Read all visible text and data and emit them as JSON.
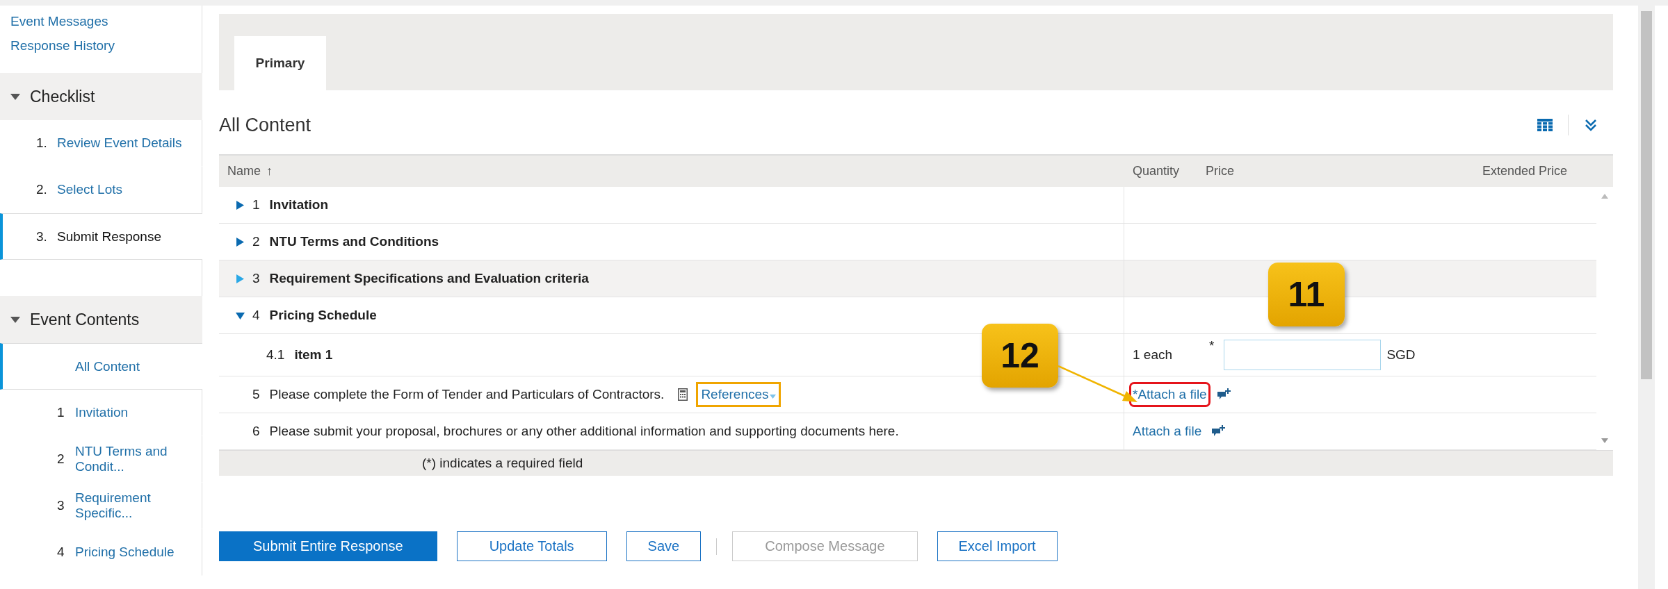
{
  "sidebar": {
    "links": [
      "Event Messages",
      "Response History"
    ],
    "sections": [
      {
        "title": "Checklist",
        "expanded": true,
        "items": [
          {
            "number": "1.",
            "label": "Review Event Details",
            "selected": false
          },
          {
            "number": "2.",
            "label": "Select Lots",
            "selected": false
          },
          {
            "number": "3.",
            "label": "Submit Response",
            "selected": true
          }
        ]
      },
      {
        "title": "Event Contents",
        "expanded": true,
        "items": [
          {
            "label": "All Content",
            "selected": true
          },
          {
            "number": "1",
            "label": "Invitation",
            "selected": false
          },
          {
            "number": "2",
            "label": "NTU Terms and Condit...",
            "selected": false
          },
          {
            "number": "3",
            "label": "Requirement Specific...",
            "selected": false
          },
          {
            "number": "4",
            "label": "Pricing Schedule",
            "selected": false
          }
        ]
      }
    ]
  },
  "tabs": [
    {
      "label": "Primary",
      "selected": true
    }
  ],
  "content": {
    "title": "All Content",
    "columns": {
      "name": "Name",
      "sort_icon": "↑",
      "quantity": "Quantity",
      "price": "Price",
      "extended_price": "Extended Price"
    },
    "rows": [
      {
        "kind": "group",
        "number": "1",
        "label": "Invitation",
        "expanded": false,
        "highlighted": false
      },
      {
        "kind": "group",
        "number": "2",
        "label": "NTU Terms and Conditions",
        "expanded": false,
        "highlighted": false
      },
      {
        "kind": "group",
        "number": "3",
        "label": "Requirement Specifications and Evaluation criteria",
        "expanded": false,
        "highlighted": true
      },
      {
        "kind": "group",
        "number": "4",
        "label": "Pricing Schedule",
        "expanded": true,
        "highlighted": false
      },
      {
        "kind": "item",
        "number": "4.1",
        "label": "item 1",
        "quantity": "1 each",
        "required": true,
        "required_mark": "*",
        "currency": "SGD",
        "highlighted": false
      },
      {
        "kind": "question",
        "number": "5",
        "label": "Please complete the Form of Tender and Particulars of Contractors.",
        "references": "References",
        "references_outlined": true,
        "attach": "*Attach a file",
        "attach_outlined": true,
        "highlighted": false
      },
      {
        "kind": "question",
        "number": "6",
        "label": "Please submit your proposal, brochures or any other additional information and supporting documents here.",
        "attach": "Attach a file",
        "attach_outlined": false,
        "highlighted": false
      }
    ],
    "footnote": "(*) indicates a required field"
  },
  "buttons": [
    {
      "label": "Submit Entire Response",
      "kind": "primary"
    },
    {
      "label": "Update Totals",
      "kind": "secondary"
    },
    {
      "label": "Save",
      "kind": "secondary"
    },
    {
      "label": "Compose Message",
      "kind": "disabled"
    },
    {
      "label": "Excel Import",
      "kind": "secondary"
    }
  ],
  "callouts": [
    {
      "label": "11"
    },
    {
      "label": "12"
    }
  ]
}
